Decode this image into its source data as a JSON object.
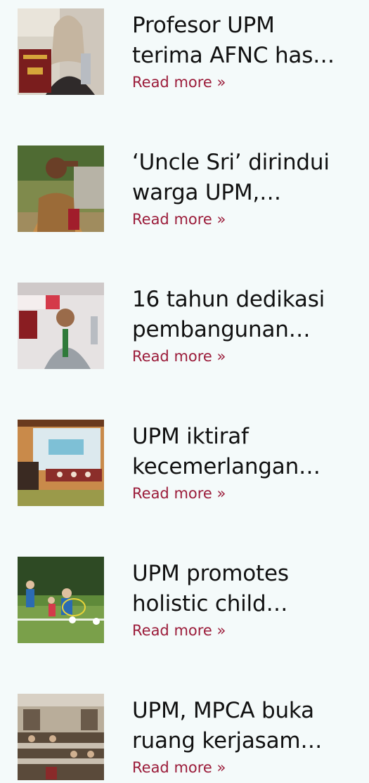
{
  "articles": [
    {
      "title_line1": "Profesor UPM",
      "title_line2": "terima AFNC has…",
      "read_more": "Read more »",
      "thumb_colors": [
        "#7a2a1e",
        "#c9b9a8",
        "#e8e2d8",
        "#3a2a2a"
      ]
    },
    {
      "title_line1": "‘Uncle Sri’ dirindui",
      "title_line2": "warga UPM,…",
      "read_more": "Read more »",
      "thumb_colors": [
        "#5d6b3a",
        "#c59a4a",
        "#8a4b2c",
        "#2b3b23"
      ]
    },
    {
      "title_line1": "16 tahun dedikasi",
      "title_line2": "pembangunan…",
      "read_more": "Read more »",
      "thumb_colors": [
        "#b23b45",
        "#e7e2e0",
        "#9aa0a6",
        "#3d3d3d"
      ]
    },
    {
      "title_line1": "UPM iktiraf",
      "title_line2": "kecemerlangan…",
      "read_more": "Read more »",
      "thumb_colors": [
        "#c77a3a",
        "#d9e6ea",
        "#8b3e3a",
        "#5a6a3a"
      ]
    },
    {
      "title_line1": "UPM promotes",
      "title_line2": "holistic child…",
      "read_more": "Read more »",
      "thumb_colors": [
        "#3a5b2a",
        "#5f8a3a",
        "#2b6bb3",
        "#c9d3c0"
      ]
    },
    {
      "title_line1": "UPM, MPCA buka",
      "title_line2": "ruang kerjasam…",
      "read_more": "Read more »",
      "thumb_colors": [
        "#5a4a3a",
        "#c9bfb0",
        "#8a2a2a",
        "#3a3a3a"
      ]
    }
  ]
}
